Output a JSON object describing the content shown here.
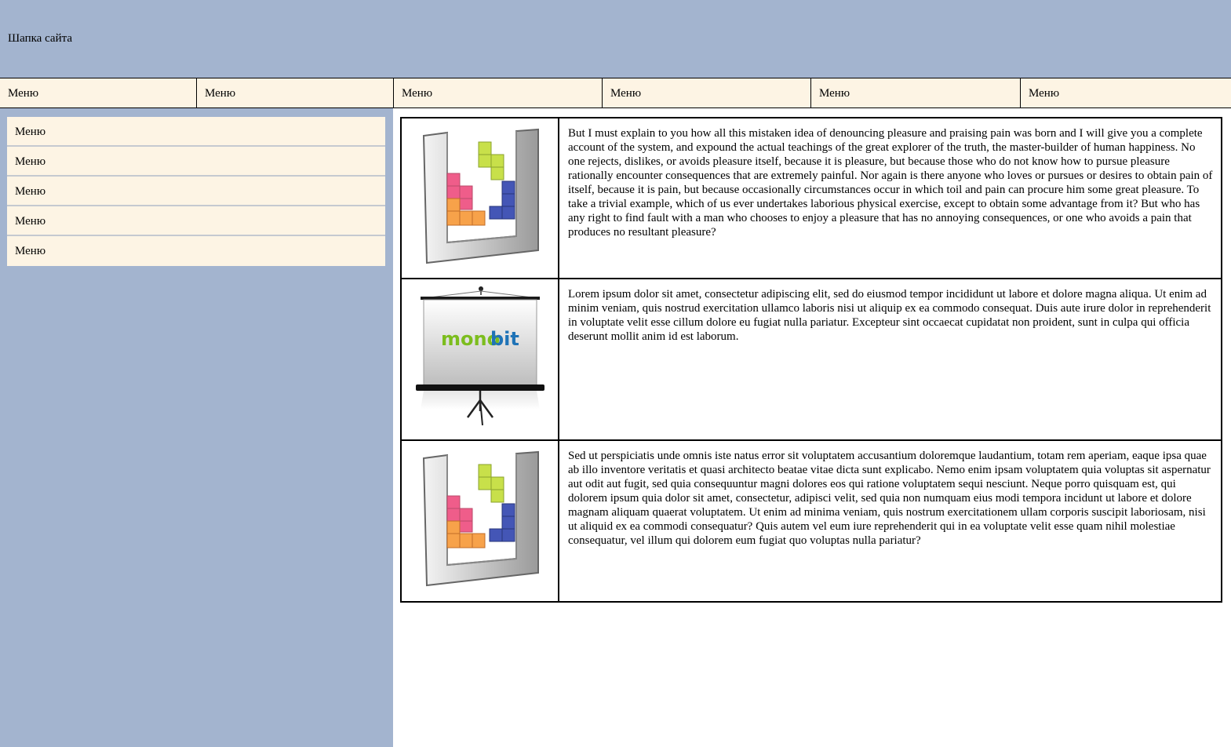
{
  "header": {
    "title": "Шапка сайта"
  },
  "topnav": {
    "items": [
      "Меню",
      "Меню",
      "Меню",
      "Меню",
      "Меню",
      "Меню"
    ]
  },
  "sidebar": {
    "items": [
      "Меню",
      "Меню",
      "Меню",
      "Меню",
      "Меню"
    ]
  },
  "content": {
    "rows": [
      {
        "image": "tetris-icon",
        "text": "But I must explain to you how all this mistaken idea of denouncing pleasure and praising pain was born and I will give you a complete account of the system, and expound the actual teachings of the great explorer of the truth, the master-builder of human happiness. No one rejects, dislikes, or avoids pleasure itself, because it is pleasure, but because those who do not know how to pursue pleasure rationally encounter consequences that are extremely painful. Nor again is there anyone who loves or pursues or desires to obtain pain of itself, because it is pain, but because occasionally circumstances occur in which toil and pain can procure him some great pleasure. To take a trivial example, which of us ever undertakes laborious physical exercise, except to obtain some advantage from it? But who has any right to find fault with a man who chooses to enjoy a pleasure that has no annoying consequences, or one who avoids a pain that produces no resultant pleasure?"
      },
      {
        "image": "projector-screen-icon",
        "logo_part1": "mono",
        "logo_part2": "bit",
        "text": "Lorem ipsum dolor sit amet, consectetur adipiscing elit, sed do eiusmod tempor incididunt ut labore et dolore magna aliqua. Ut enim ad minim veniam, quis nostrud exercitation ullamco laboris nisi ut aliquip ex ea commodo consequat. Duis aute irure dolor in reprehenderit in voluptate velit esse cillum dolore eu fugiat nulla pariatur. Excepteur sint occaecat cupidatat non proident, sunt in culpa qui officia deserunt mollit anim id est laborum."
      },
      {
        "image": "tetris-icon",
        "text": "Sed ut perspiciatis unde omnis iste natus error sit voluptatem accusantium doloremque laudantium, totam rem aperiam, eaque ipsa quae ab illo inventore veritatis et quasi architecto beatae vitae dicta sunt explicabo. Nemo enim ipsam voluptatem quia voluptas sit aspernatur aut odit aut fugit, sed quia consequuntur magni dolores eos qui ratione voluptatem sequi nesciunt. Neque porro quisquam est, qui dolorem ipsum quia dolor sit amet, consectetur, adipisci velit, sed quia non numquam eius modi tempora incidunt ut labore et dolore magnam aliquam quaerat voluptatem. Ut enim ad minima veniam, quis nostrum exercitationem ullam corporis suscipit laboriosam, nisi ut aliquid ex ea commodi consequatur? Quis autem vel eum iure reprehenderit qui in ea voluptate velit esse quam nihil molestiae consequatur, vel illum qui dolorem eum fugiat quo voluptas nulla pariatur?"
      }
    ]
  },
  "colors": {
    "header_bg": "#a3b4cf",
    "menu_bg": "#fdf4e4",
    "logo_green": "#7cbd1e",
    "logo_blue": "#1f73b7"
  }
}
